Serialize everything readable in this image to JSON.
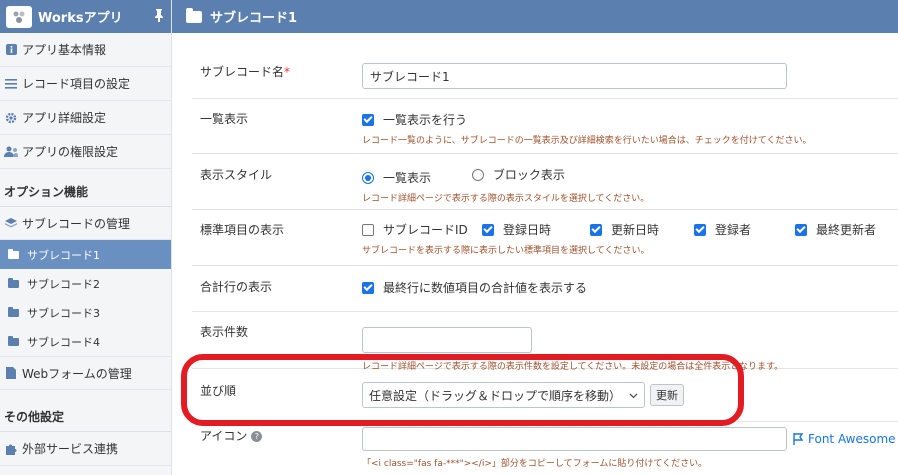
{
  "sidebar": {
    "app_title": "Worksアプリ",
    "top_items": [
      {
        "label": "アプリ基本情報",
        "icon": "info-icon"
      },
      {
        "label": "レコード項目の設定",
        "icon": "list-icon"
      },
      {
        "label": "アプリ詳細設定",
        "icon": "gear-icon"
      },
      {
        "label": "アプリの権限設定",
        "icon": "users-icon"
      }
    ],
    "option_section": "オプション機能",
    "sublist_manage": "サブレコードの管理",
    "sublist_items": [
      "サブレコード1",
      "サブレコード2",
      "サブレコード3",
      "サブレコード4"
    ],
    "web_form_manage": "Webフォームの管理",
    "other_section": "その他設定",
    "external_service": "外部サービス連携"
  },
  "page": {
    "title": "サブレコード1"
  },
  "form": {
    "name": {
      "label": "サブレコード名",
      "required_mark": "*",
      "value": "サブレコード1"
    },
    "list_display": {
      "label": "一覧表示",
      "checkbox_label": "一覧表示を行う",
      "checked": true,
      "help": "レコード一覧のように、サブレコードの一覧表示及び詳細検索を行いたい場合は、チェックを付けてください。"
    },
    "display_style": {
      "label": "表示スタイル",
      "options": [
        "一覧表示",
        "ブロック表示"
      ],
      "selected": "一覧表示",
      "help": "レコード詳細ページで表示する際の表示スタイルを選択してください。"
    },
    "standard_items": {
      "label": "標準項目の表示",
      "options": [
        {
          "label": "サブレコードID",
          "checked": false
        },
        {
          "label": "登録日時",
          "checked": true
        },
        {
          "label": "更新日時",
          "checked": true
        },
        {
          "label": "登録者",
          "checked": true
        },
        {
          "label": "最終更新者",
          "checked": true
        }
      ],
      "help": "サブレコードを表示する際に表示したい標準項目を選択してください。"
    },
    "total_row": {
      "label": "合計行の表示",
      "checkbox_label": "最終行に数値項目の合計値を表示する",
      "checked": true
    },
    "count": {
      "label": "表示件数",
      "value": "",
      "help": "レコード詳細ページで表示する際の表示件数を設定してください。未設定の場合は全件表示となります。"
    },
    "sort": {
      "label": "並び順",
      "selected": "任意設定（ドラッグ＆ドロップで順序を移動）",
      "update_button": "更新"
    },
    "icon": {
      "label": "アイコン",
      "value": "",
      "link": "Font Awesome",
      "help": "「<i class=\"fas fa-***\"></i>」部分をコピーしてフォームに貼り付けてください。"
    }
  },
  "colors": {
    "header": "#5b7fae",
    "active": "#6a8fc1",
    "highlight": "#e31b23",
    "help_text": "#a0522d"
  }
}
